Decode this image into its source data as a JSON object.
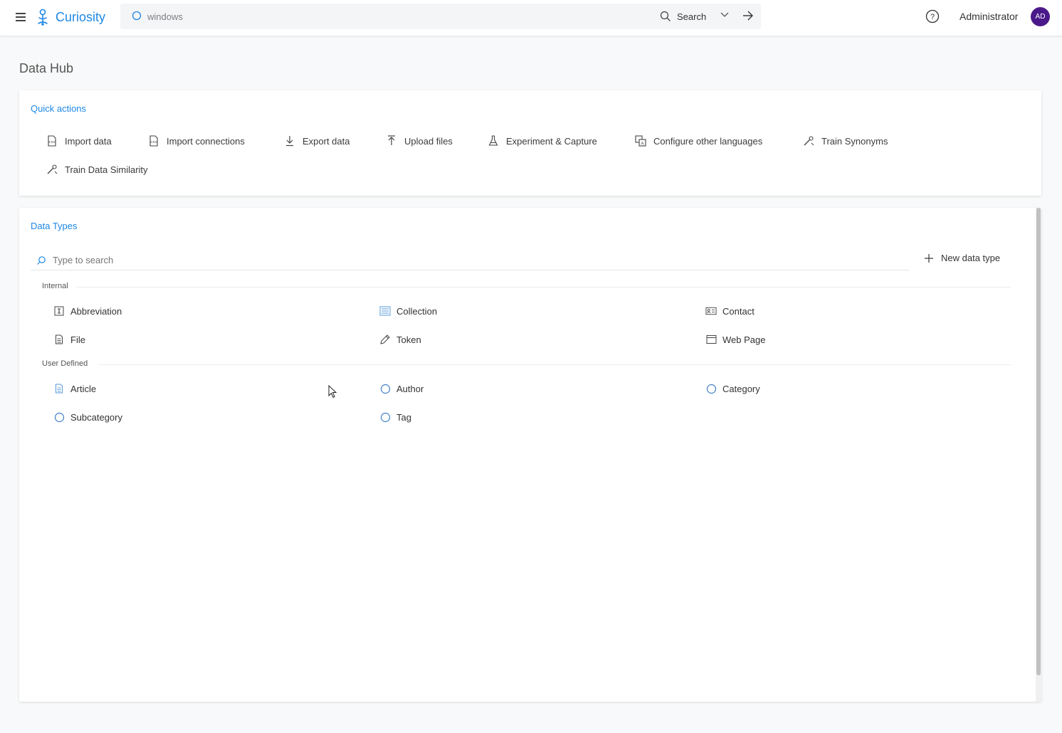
{
  "header": {
    "app_name": "Curiosity",
    "search_value": "windows",
    "search_button": "Search",
    "user_name": "Administrator",
    "avatar_initials": "AD",
    "accent_color": "#1e88e5",
    "avatar_color": "#4a1a8a"
  },
  "page": {
    "title": "Data Hub"
  },
  "quick_actions": {
    "title": "Quick actions",
    "items": [
      {
        "label": "Import data",
        "icon": "csv-file-icon"
      },
      {
        "label": "Import connections",
        "icon": "csv-file-icon"
      },
      {
        "label": "Export data",
        "icon": "download-icon"
      },
      {
        "label": "Upload files",
        "icon": "upload-icon"
      },
      {
        "label": "Experiment & Capture",
        "icon": "flask-icon"
      },
      {
        "label": "Configure other languages",
        "icon": "translate-icon"
      },
      {
        "label": "Train Synonyms",
        "icon": "wand-icon"
      },
      {
        "label": "Train Data Similarity",
        "icon": "wand-icon"
      }
    ]
  },
  "data_types": {
    "title": "Data Types",
    "search_placeholder": "Type to search",
    "new_button": "New data type",
    "groups": [
      {
        "label": "Internal",
        "items": [
          {
            "label": "Abbreviation",
            "icon": "info-box-icon"
          },
          {
            "label": "Collection",
            "icon": "list-icon"
          },
          {
            "label": "Contact",
            "icon": "contact-card-icon"
          },
          {
            "label": "File",
            "icon": "document-icon"
          },
          {
            "label": "Token",
            "icon": "pen-icon"
          },
          {
            "label": "Web Page",
            "icon": "browser-window-icon"
          }
        ]
      },
      {
        "label": "User Defined",
        "items": [
          {
            "label": "Article",
            "icon": "article-icon"
          },
          {
            "label": "Author",
            "icon": "circle-icon"
          },
          {
            "label": "Category",
            "icon": "circle-icon"
          },
          {
            "label": "Subcategory",
            "icon": "circle-icon"
          },
          {
            "label": "Tag",
            "icon": "circle-icon"
          }
        ]
      }
    ]
  }
}
